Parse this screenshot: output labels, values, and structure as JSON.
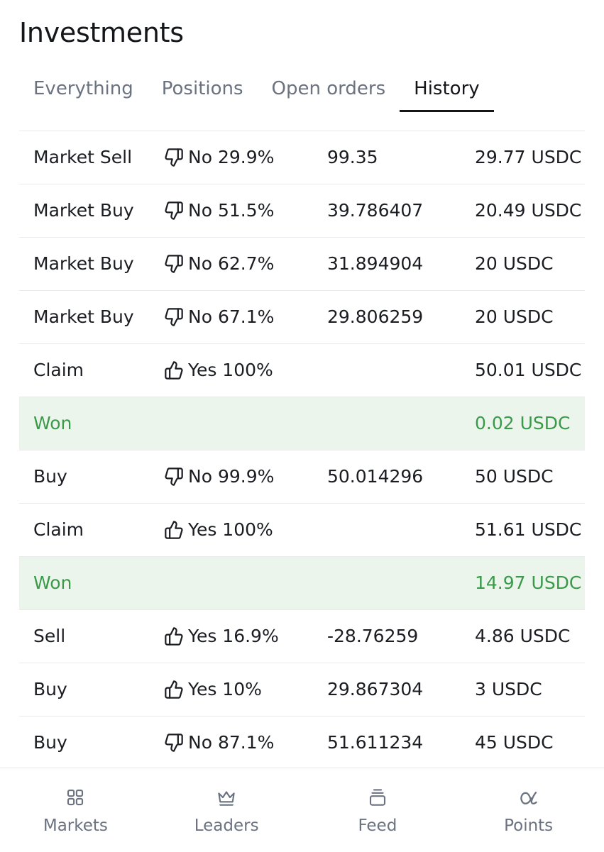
{
  "header": {
    "title": "Investments"
  },
  "tabs": [
    {
      "label": "Everything",
      "active": false
    },
    {
      "label": "Positions",
      "active": false
    },
    {
      "label": "Open orders",
      "active": false
    },
    {
      "label": "History",
      "active": true
    }
  ],
  "colors": {
    "won_text": "#3a9a4a",
    "won_background": "#ebf5ec",
    "text_primary": "#1b1d22",
    "text_muted": "#6b7280"
  },
  "history": [
    {
      "type": "Market Sell",
      "outcome_icon": "thumbs-down-icon",
      "outcome": "No 29.9%",
      "shares": "99.35",
      "amount": "29.77 USDC",
      "won": false
    },
    {
      "type": "Market Buy",
      "outcome_icon": "thumbs-down-icon",
      "outcome": "No 51.5%",
      "shares": "39.786407",
      "amount": "20.49 USDC",
      "won": false
    },
    {
      "type": "Market Buy",
      "outcome_icon": "thumbs-down-icon",
      "outcome": "No 62.7%",
      "shares": "31.894904",
      "amount": "20 USDC",
      "won": false
    },
    {
      "type": "Market Buy",
      "outcome_icon": "thumbs-down-icon",
      "outcome": "No 67.1%",
      "shares": "29.806259",
      "amount": "20 USDC",
      "won": false
    },
    {
      "type": "Claim",
      "outcome_icon": "thumbs-up-icon",
      "outcome": "Yes 100%",
      "shares": "",
      "amount": "50.01 USDC",
      "won": false
    },
    {
      "type": "Won",
      "outcome_icon": "",
      "outcome": "",
      "shares": "",
      "amount": "0.02 USDC",
      "won": true
    },
    {
      "type": "Buy",
      "outcome_icon": "thumbs-down-icon",
      "outcome": "No 99.9%",
      "shares": "50.014296",
      "amount": "50 USDC",
      "won": false
    },
    {
      "type": "Claim",
      "outcome_icon": "thumbs-up-icon",
      "outcome": "Yes 100%",
      "shares": "",
      "amount": "51.61 USDC",
      "won": false
    },
    {
      "type": "Won",
      "outcome_icon": "",
      "outcome": "",
      "shares": "",
      "amount": "14.97 USDC",
      "won": true
    },
    {
      "type": "Sell",
      "outcome_icon": "thumbs-up-icon",
      "outcome": "Yes 16.9%",
      "shares": "-28.76259",
      "amount": "4.86 USDC",
      "won": false
    },
    {
      "type": "Buy",
      "outcome_icon": "thumbs-up-icon",
      "outcome": "Yes 10%",
      "shares": "29.867304",
      "amount": "3 USDC",
      "won": false
    },
    {
      "type": "Buy",
      "outcome_icon": "thumbs-down-icon",
      "outcome": "No 87.1%",
      "shares": "51.611234",
      "amount": "45 USDC",
      "won": false
    }
  ],
  "bottom_nav": [
    {
      "label": "Markets",
      "icon": "grid-icon"
    },
    {
      "label": "Leaders",
      "icon": "crown-icon"
    },
    {
      "label": "Feed",
      "icon": "stack-icon"
    },
    {
      "label": "Points",
      "icon": "alpha-icon"
    }
  ]
}
